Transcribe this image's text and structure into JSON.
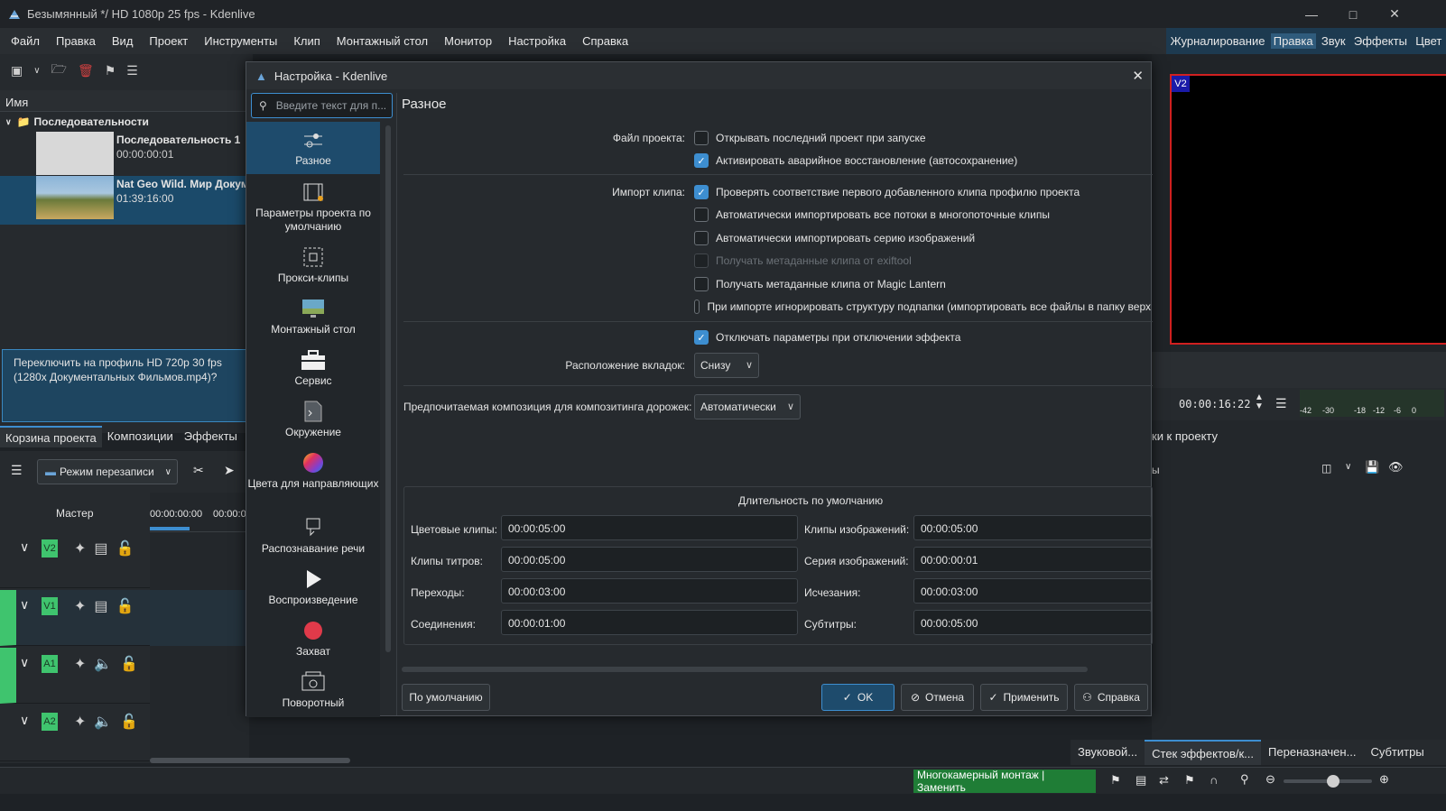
{
  "window": {
    "title": "Безымянный */ HD 1080p 25 fps - Kdenlive"
  },
  "menu": [
    "Файл",
    "Правка",
    "Вид",
    "Проект",
    "Инструменты",
    "Клип",
    "Монтажный стол",
    "Монитор",
    "Настройка",
    "Справка"
  ],
  "layouts": [
    {
      "label": "Журналирование"
    },
    {
      "label": "Правка"
    },
    {
      "label": "Звук"
    },
    {
      "label": "Эффекты"
    },
    {
      "label": "Цвет"
    }
  ],
  "bin": {
    "column_name": "Имя",
    "folder": "Последовательности",
    "clips": [
      {
        "name": "Последовательность 1",
        "duration": "00:00:00:01"
      },
      {
        "name": "Nat Geo Wild. Мир Докум",
        "duration": "01:39:16:00"
      }
    ],
    "message": "Переключить на профиль HD 720p 30 fps (1280x Документальных Фильмов.mp4)?",
    "tabs": [
      "Корзина проекта",
      "Композиции",
      "Эффекты"
    ]
  },
  "timeline": {
    "mode": "Режим перезаписи",
    "master": "Мастер",
    "ruler": [
      "00:00:00:00",
      "00:00:0"
    ],
    "tracks": [
      "V2",
      "V1",
      "A1",
      "A2"
    ]
  },
  "monitor": {
    "badge": "V2",
    "timecode": "00:00:16:22",
    "meter": [
      "-42",
      "-30",
      "-18",
      "-12",
      "-6",
      "0"
    ]
  },
  "right_panel": {
    "tab_partial": "ки к проекту",
    "text_partial": "ы",
    "tabs": [
      "Звуковой...",
      "Стек эффектов/к...",
      "Переназначен...",
      "Субтитры"
    ]
  },
  "status": {
    "multicam": "Многокамерный монтаж | Заменить"
  },
  "dialog": {
    "title": "Настройка - Kdenlive",
    "search_placeholder": "Введите текст для п...",
    "page_title": "Разное",
    "categories": [
      {
        "label": "Разное",
        "icon": "sliders-icon"
      },
      {
        "label": "Параметры проекта по умолчанию",
        "icon": "film-gear-icon"
      },
      {
        "label": "Прокси-клипы",
        "icon": "proxy-icon"
      },
      {
        "label": "Монтажный стол",
        "icon": "monitor-icon"
      },
      {
        "label": "Сервис",
        "icon": "toolbox-icon"
      },
      {
        "label": "Окружение",
        "icon": "terminal-icon"
      },
      {
        "label": "Цвета для направляющих",
        "icon": "color-wheel-icon"
      },
      {
        "label": "Распознавание речи",
        "icon": "speech-icon"
      },
      {
        "label": "Воспроизведение",
        "icon": "play-icon"
      },
      {
        "label": "Захват",
        "icon": "record-icon"
      },
      {
        "label": "Поворотный",
        "icon": "jog-shuttle-icon"
      }
    ],
    "project_file_label": "Файл проекта:",
    "project_file": [
      {
        "label": "Открывать последний проект при запуске",
        "checked": false
      },
      {
        "label": "Активировать аварийное восстановление (автосохранение)",
        "checked": true
      }
    ],
    "import_label": "Импорт клипа:",
    "import": [
      {
        "label": "Проверять соответствие первого добавленного клипа профилю проекта",
        "checked": true
      },
      {
        "label": "Автоматически импортировать все потоки в многопоточные клипы",
        "checked": false
      },
      {
        "label": "Автоматически импортировать серию изображений",
        "checked": false
      },
      {
        "label": "Получать метаданные клипа от exiftool",
        "checked": false,
        "disabled": true
      },
      {
        "label": "Получать метаданные клипа от Magic Lantern",
        "checked": false
      },
      {
        "label": "При импорте игнорировать структуру подпапки (импортировать все файлы в папку верх",
        "checked": false
      }
    ],
    "disable_effect": {
      "label": "Отключать параметры при отключении эффекта",
      "checked": true
    },
    "tab_position_label": "Расположение вкладок:",
    "tab_position": "Снизу",
    "composition_label": "Предпочитаемая композиция для композитинга дорожек:",
    "composition": "Автоматически",
    "durations_title": "Длительность по умолчанию",
    "durations": [
      {
        "label": "Цветовые клипы:",
        "value": "00:00:05:00"
      },
      {
        "label": "Клипы изображений:",
        "value": "00:00:05:00"
      },
      {
        "label": "Клипы титров:",
        "value": "00:00:05:00"
      },
      {
        "label": "Серия изображений:",
        "value": "00:00:00:01"
      },
      {
        "label": "Переходы:",
        "value": "00:00:03:00"
      },
      {
        "label": "Исчезания:",
        "value": "00:00:03:00"
      },
      {
        "label": "Соединения:",
        "value": "00:00:01:00"
      },
      {
        "label": "Субтитры:",
        "value": "00:00:05:00"
      }
    ],
    "buttons": {
      "defaults": "По умолчанию",
      "ok": "OK",
      "cancel": "Отмена",
      "apply": "Применить",
      "help": "Справка"
    }
  }
}
